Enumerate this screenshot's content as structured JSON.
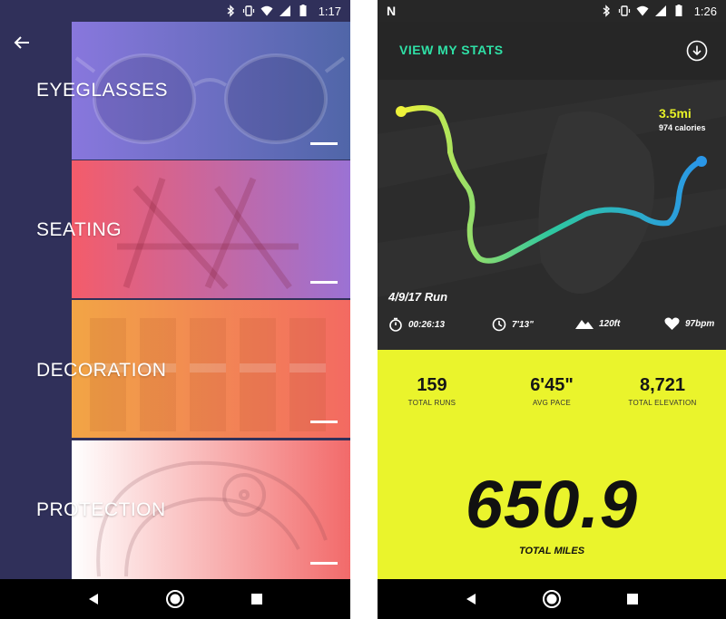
{
  "left_phone": {
    "status_time": "1:17",
    "categories": [
      {
        "label": "EYEGLASSES"
      },
      {
        "label": "SEATING"
      },
      {
        "label": "DECORATION"
      },
      {
        "label": "PROTECTION"
      }
    ],
    "colors": {
      "sidebar": "#30305a",
      "eyeglasses_from": "#8877dd",
      "eyeglasses_to": "#5066a8",
      "seating_from": "#f45c6a",
      "seating_to": "#9b72d4",
      "decoration_from": "#f2a545",
      "decoration_to": "#f36a62",
      "protection_from": "#ffffff",
      "protection_to": "#f26a6a"
    }
  },
  "right_phone": {
    "status_time": "1:26",
    "header_title": "VIEW MY STATS",
    "distance": "3.5mi",
    "calories": "974 calories",
    "run_date": "4/9/17 Run",
    "map_stats": [
      {
        "icon": "stopwatch-icon",
        "value": "00:26:13"
      },
      {
        "icon": "clock-icon",
        "value": "7'13\""
      },
      {
        "icon": "mountain-icon",
        "value": "120ft"
      },
      {
        "icon": "heart-icon",
        "value": "97bpm"
      }
    ],
    "summary": [
      {
        "value": "159",
        "label": "TOTAL RUNS"
      },
      {
        "value": "6'45\"",
        "label": "AVG PACE"
      },
      {
        "value": "8,721",
        "label": "TOTAL ELEVATION"
      }
    ],
    "total_miles": "650.9",
    "total_miles_label": "TOTAL MILES",
    "colors": {
      "accent_title": "#2fe0a6",
      "distance": "#e8f227",
      "stats_panel": "#eaf42c",
      "route_start": "#eef23a",
      "route_mid": "#2ec7a0",
      "route_end": "#2a97e8"
    }
  }
}
